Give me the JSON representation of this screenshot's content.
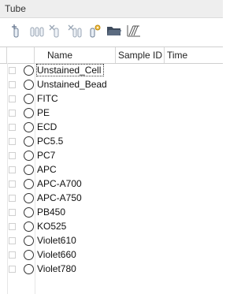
{
  "panel": {
    "title": "Tube"
  },
  "toolbar": {
    "buttons": [
      {
        "icon": "add-tube-icon"
      },
      {
        "icon": "tubes-icon"
      },
      {
        "icon": "delete-tube-icon"
      },
      {
        "icon": "delete-all-tubes-icon"
      },
      {
        "icon": "tube-settings-icon"
      },
      {
        "icon": "open-folder-icon"
      },
      {
        "icon": "compensation-icon"
      }
    ]
  },
  "table": {
    "columns": [
      "Name",
      "Sample ID",
      "Time"
    ],
    "rows": [
      {
        "name": "Unstained_Cell",
        "selected": true
      },
      {
        "name": "Unstained_Bead"
      },
      {
        "name": "FITC"
      },
      {
        "name": "PE"
      },
      {
        "name": "ECD"
      },
      {
        "name": "PC5.5"
      },
      {
        "name": "PC7"
      },
      {
        "name": "APC"
      },
      {
        "name": "APC-A700"
      },
      {
        "name": "APC-A750"
      },
      {
        "name": "PB450"
      },
      {
        "name": "KO525"
      },
      {
        "name": "Violet610"
      },
      {
        "name": "Violet660"
      },
      {
        "name": "Violet780"
      }
    ]
  }
}
